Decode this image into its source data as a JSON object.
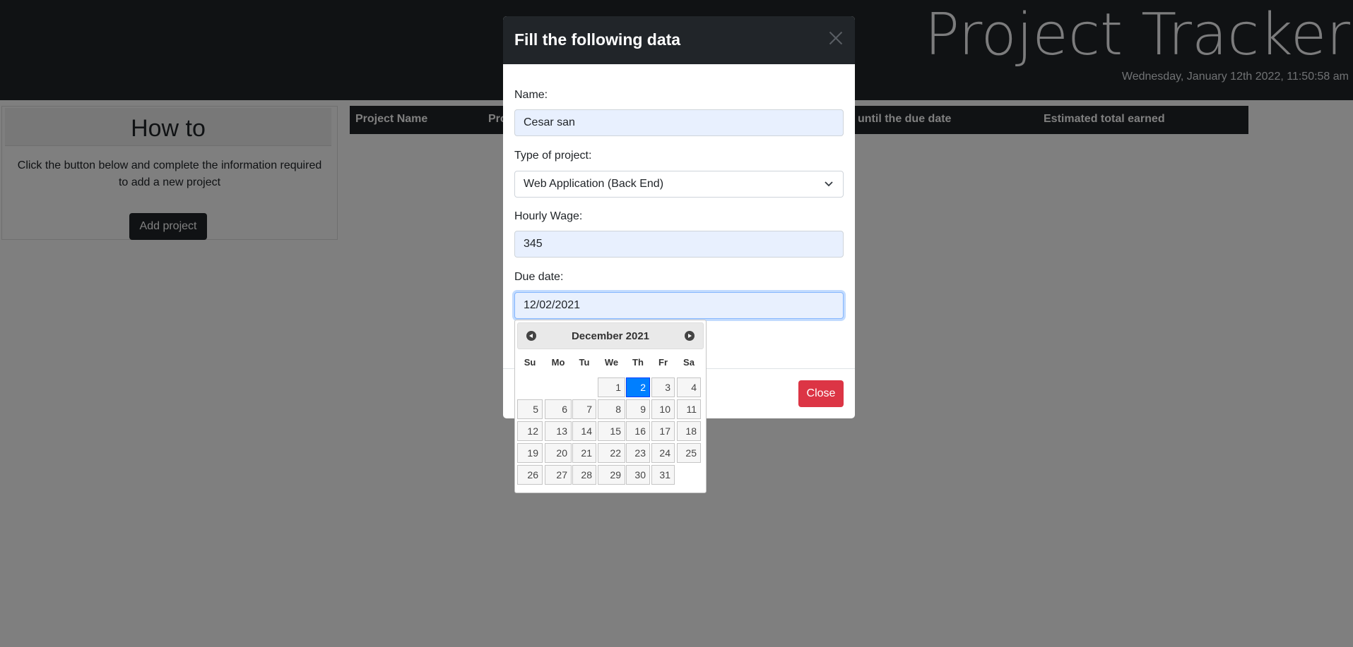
{
  "header": {
    "app_title": "Project Tracker",
    "clock": "Wednesday, January 12th 2022, 11:50:58 am"
  },
  "howto": {
    "title": "How to",
    "text": "Click the button below and complete the information required to add a new project",
    "add_button": "Add project"
  },
  "table": {
    "columns": [
      "Project Name",
      "Pro",
      "until the due date",
      "Estimated total earned"
    ]
  },
  "modal": {
    "title": "Fill the following data",
    "name_label": "Name:",
    "name_value": "Cesar san",
    "type_label": "Type of project:",
    "type_value": "Web Application (Back End)",
    "wage_label": "Hourly Wage:",
    "wage_value": "345",
    "due_label": "Due date:",
    "due_value": "12/02/2021",
    "close_button": "Close"
  },
  "datepicker": {
    "month_title": "December 2021",
    "weekdays": [
      "Su",
      "Mo",
      "Tu",
      "We",
      "Th",
      "Fr",
      "Sa"
    ],
    "first_weekday_index": 3,
    "days_in_month": 31,
    "selected_day": 2
  },
  "colors": {
    "header_bg": "#212529",
    "close_button": "#dc3545",
    "selected_day": "#007fff"
  }
}
